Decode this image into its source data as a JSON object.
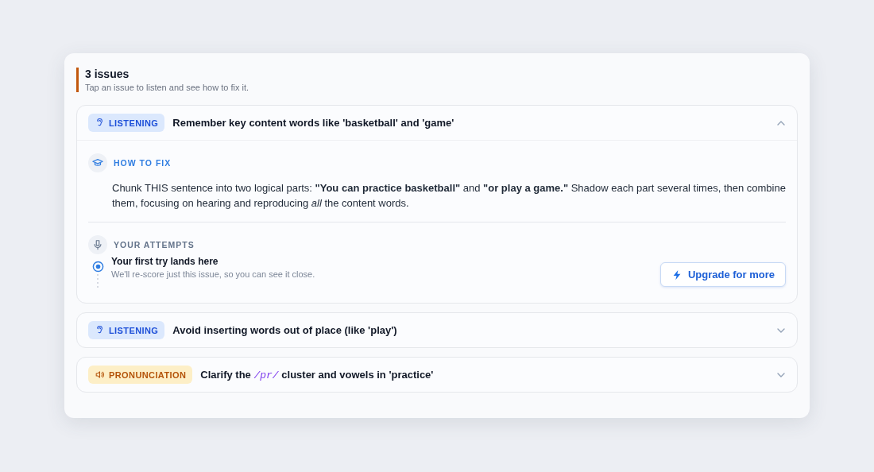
{
  "header": {
    "title": "3 issues",
    "subtitle": "Tap an issue to listen and see how to fix it."
  },
  "issues": [
    {
      "kind": "listening",
      "tag": "LISTENING",
      "title": "Remember key content words like 'basketball' and 'game'",
      "expanded": true,
      "how_to_fix": {
        "label": "HOW TO FIX",
        "text": "Chunk THIS sentence into two logical parts: **\"You can practice basketball\"** and **\"or play a game.\"** Shadow each part several times, then combine them, focusing on hearing and reproducing *all* the content words."
      },
      "attempts": {
        "label": "YOUR ATTEMPTS",
        "first_try": "Your first try lands here",
        "note": "We'll re-score just this issue, so you can see it close.",
        "button": "Upgrade for more"
      }
    },
    {
      "kind": "listening",
      "tag": "LISTENING",
      "title": "Avoid inserting words out of place (like 'play')",
      "expanded": false
    },
    {
      "kind": "pronunciation",
      "tag": "PRONUNCIATION",
      "title": "Clarify the */pr/* cluster and vowels in 'practice'",
      "expanded": false
    }
  ]
}
